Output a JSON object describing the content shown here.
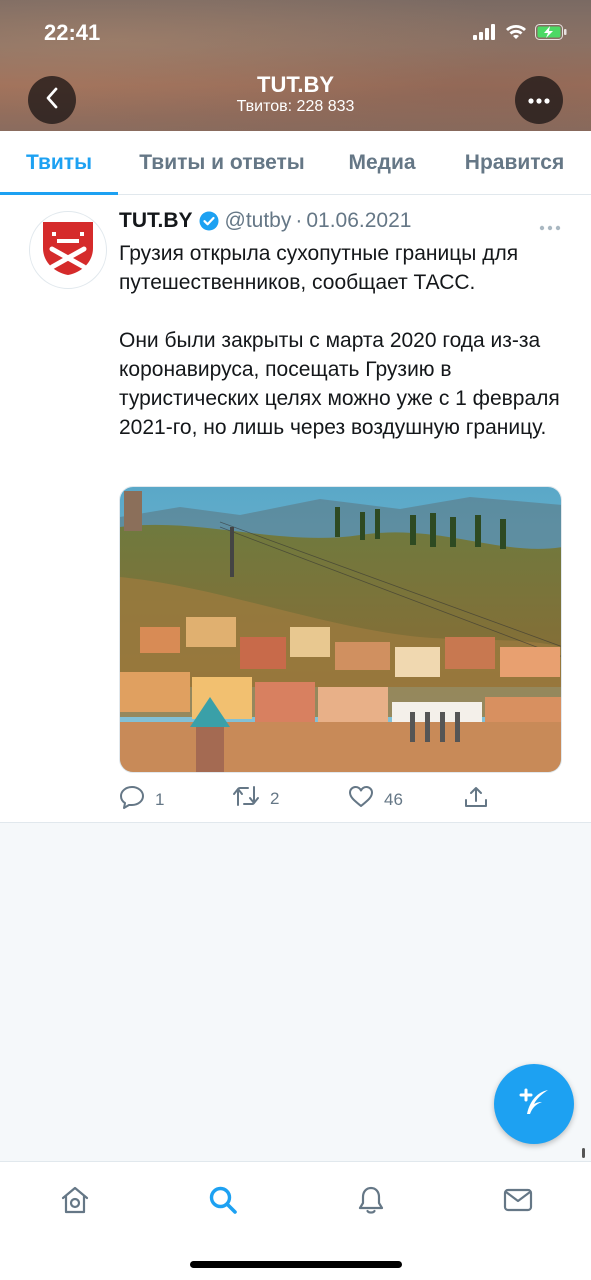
{
  "status_bar": {
    "time": "22:41",
    "icons": [
      "signal-icon",
      "wifi-icon",
      "battery-charging-icon"
    ]
  },
  "header": {
    "title": "TUT.BY",
    "subtitle": "Твитов: 228 833",
    "back_icon": "chevron-left-icon",
    "more_icon": "more-horizontal-icon"
  },
  "tabs": [
    {
      "label": "Твиты",
      "active": true
    },
    {
      "label": "Твиты и ответы",
      "active": false
    },
    {
      "label": "Медиа",
      "active": false
    },
    {
      "label": "Нравится",
      "active": false
    }
  ],
  "tweet": {
    "author": "TUT.BY",
    "verified": true,
    "handle": "@tutby",
    "separator": "·",
    "date": "01.06.2021",
    "text": [
      "Грузия открыла сухопутные границы для путешественников, сообщает ТАСС.",
      "Они были закрыты с марта 2020 года из-за коронавируса, посещать Грузию в туристических целях можно уже с 1 февраля 2021-го, но лишь через воздушную границу."
    ],
    "actions": {
      "replies": "1",
      "retweets": "2",
      "likes": "46"
    }
  },
  "bottom_nav": [
    "home-icon",
    "search-icon",
    "notifications-icon",
    "messages-icon"
  ],
  "colors": {
    "accent": "#1DA1F2",
    "text": "#14171A",
    "secondary": "#657786",
    "logo_red": "#D52B2B"
  }
}
